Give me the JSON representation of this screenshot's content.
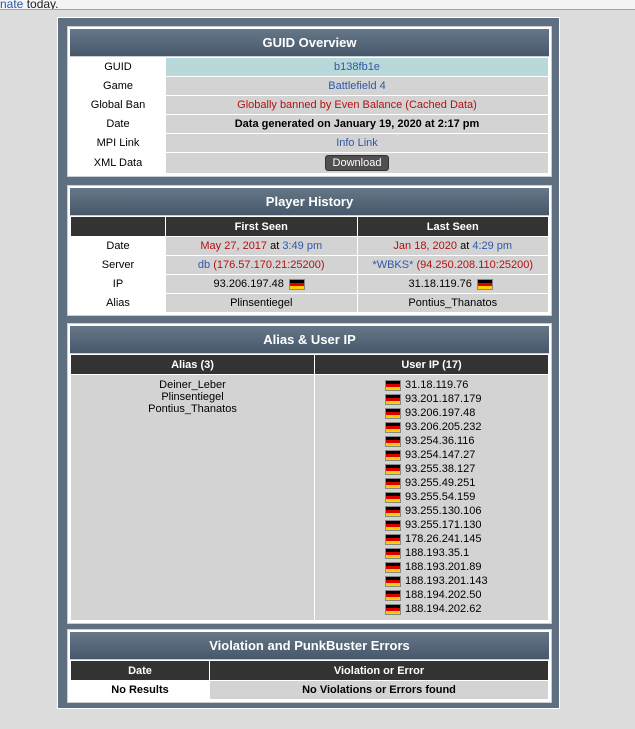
{
  "top_text": {
    "link": "nate",
    "rest": " today."
  },
  "guid_overview": {
    "title": "GUID Overview",
    "rows": [
      {
        "label": "GUID",
        "value": "b138fb1e"
      },
      {
        "label": "Game",
        "value": "Battlefield 4"
      },
      {
        "label": "Global Ban",
        "value": "Globally banned by Even Balance (Cached Data)"
      },
      {
        "label": "Date",
        "value": "Data generated on January 19, 2020 at 2:17 pm"
      },
      {
        "label": "MPI Link",
        "value": "Info Link"
      },
      {
        "label": "XML Data",
        "value": "Download"
      }
    ]
  },
  "player_history": {
    "title": "Player History",
    "headers": [
      "First Seen",
      "Last Seen"
    ],
    "date": {
      "label": "Date",
      "first_date": "May 27, 2017",
      "first_time": "3:49 pm",
      "last_date": "Jan 18, 2020",
      "last_time": "4:29 pm",
      "at": "at"
    },
    "server": {
      "label": "Server",
      "first_name": "db",
      "first_addr": "(176.57.170.21:25200)",
      "last_name": "*WBKS*",
      "last_addr": "(94.250.208.110:25200)"
    },
    "ip": {
      "label": "IP",
      "first": "93.206.197.48",
      "last": "31.18.119.76"
    },
    "alias": {
      "label": "Alias",
      "first": "Plinsentiegel",
      "last": "Pontius_Thanatos"
    }
  },
  "alias_user_ip": {
    "title": "Alias & User IP",
    "alias_header": "Alias (3)",
    "ip_header": "User IP (17)",
    "aliases": [
      "Deiner_Leber",
      "Plinsentiegel",
      "Pontius_Thanatos"
    ],
    "ips": [
      "31.18.119.76",
      "93.201.187.179",
      "93.206.197.48",
      "93.206.205.232",
      "93.254.36.116",
      "93.254.147.27",
      "93.255.38.127",
      "93.255.49.251",
      "93.255.54.159",
      "93.255.130.106",
      "93.255.171.130",
      "178.26.241.145",
      "188.193.35.1",
      "188.193.201.89",
      "188.193.201.143",
      "188.194.202.50",
      "188.194.202.62"
    ]
  },
  "violations": {
    "title": "Violation and PunkBuster Errors",
    "headers": [
      "Date",
      "Violation or Error"
    ],
    "row": [
      "No Results",
      "No Violations or Errors found"
    ]
  }
}
